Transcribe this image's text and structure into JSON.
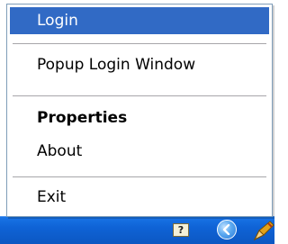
{
  "menu": {
    "items": [
      {
        "label": "Login",
        "selected": true,
        "bold": false
      },
      {
        "label": "Popup Login Window",
        "selected": false,
        "bold": false
      },
      {
        "label": "Properties",
        "selected": false,
        "bold": true
      },
      {
        "label": "About",
        "selected": false,
        "bold": false
      },
      {
        "label": "Exit",
        "selected": false,
        "bold": false
      }
    ]
  },
  "taskbar": {
    "help_icon_glyph": "?",
    "icons": [
      "help-icon",
      "back-arrow-icon",
      "pen-icon"
    ]
  },
  "colors": {
    "selection": "#316ac5",
    "menu_border": "#7f9db9",
    "taskbar": "#0f63d6"
  }
}
